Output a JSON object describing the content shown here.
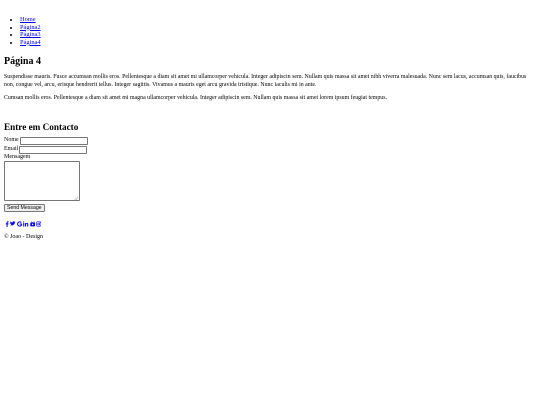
{
  "nav": {
    "items": [
      {
        "label": "Home"
      },
      {
        "label": "Página2"
      },
      {
        "label": "Página3"
      },
      {
        "label": "Página4"
      }
    ]
  },
  "main": {
    "title": "Página 4",
    "paragraphs": [
      "Suspendisse mauris. Fusce accumsan mollis eros. Pellentesque a diam sit amet mi ullamcorper vehicula. Integer adipiscin sem. Nullam quis massa sit amet nibh viverra malesuada. Nunc sem lacus, accumsan quis, faucibus non, congue vel, arcu, erisque hendrerit tellus. Integer sagittis. Vivamus a mauris eget arcu gravida tristique. Nunc iaculis mi in ante.",
      "Cumsan mollis eros. Pellentesque a diam sit amet mi magna ullamcorper vehicula. Integer adipiscin sem. Nullam quis massa sit amet lorem ipsum feugiat tempus."
    ]
  },
  "contact": {
    "title": "Entre em Contacto",
    "name_label": "Nome",
    "name_value": "",
    "email_label": "Email",
    "email_value": "",
    "message_label": "Mensagem",
    "message_value": "",
    "submit_label": "Send Message"
  },
  "social": {
    "icons": [
      "facebook-icon",
      "twitter-icon",
      "google-icon",
      "linkedin-icon",
      "youtube-icon",
      "instagram-icon"
    ],
    "link_color": "#0000ee"
  },
  "footer": {
    "text": "© Joao - Design"
  }
}
